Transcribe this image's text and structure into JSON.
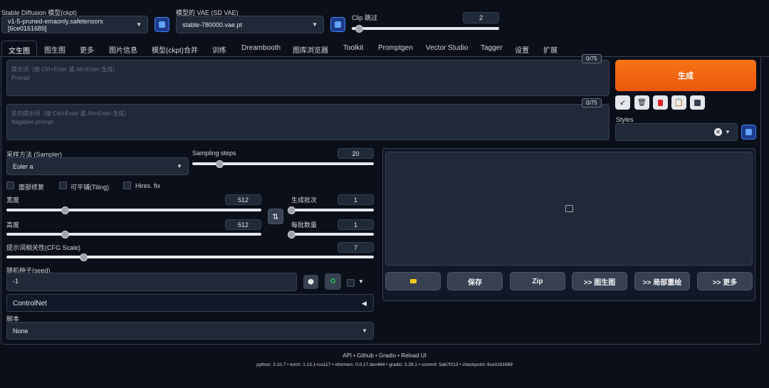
{
  "top": {
    "ckpt_label": "Stable Diffusion 模型(ckpt)",
    "ckpt_value": "v1-5-pruned-emaonly.safetensors [6ce0161689]",
    "vae_label": "模型的 VAE (SD VAE)",
    "vae_value": "stable-780000.vae.pt",
    "clip_label": "Clip 跳过",
    "clip_value": "2",
    "clip_fraction": 0.05
  },
  "tabs": [
    "文生图",
    "图生图",
    "更多",
    "图片信息",
    "模型(ckpt)合并",
    "训练",
    "Dreambooth",
    "图库浏览器",
    "Toolkit",
    "Promptgen",
    "Vector Studio",
    "Tagger",
    "设置",
    "扩展"
  ],
  "prompt": {
    "placeholder_cn": "提示词（按 Ctrl+Enter 或 Alt+Enter 生成）",
    "placeholder_en": "Prompt",
    "counter": "0/75"
  },
  "negative_prompt": {
    "placeholder_cn": "反向提示词（按 Ctrl+Enter 或 Alt+Enter 生成）",
    "placeholder_en": "Negative prompt",
    "counter": "0/75"
  },
  "generate_label": "生成",
  "styles_label": "Styles",
  "sampler": {
    "label": "采样方法 (Sampler)",
    "value": "Euler a"
  },
  "steps": {
    "label": "Sampling steps",
    "value": "20",
    "fraction": 0.15
  },
  "checkboxes": {
    "face": "面部修复",
    "tiling": "可平铺(Tiling)",
    "hires": "Hires. fix"
  },
  "width": {
    "label": "宽度",
    "value": "512",
    "fraction": 0.23
  },
  "height": {
    "label": "高度",
    "value": "512",
    "fraction": 0.23
  },
  "batch_count": {
    "label": "生成批次",
    "value": "1",
    "fraction": 0.0
  },
  "batch_size": {
    "label": "每批数量",
    "value": "1",
    "fraction": 0.0
  },
  "cfg": {
    "label": "提示词相关性(CFG Scale)",
    "value": "7",
    "fraction": 0.21
  },
  "seed": {
    "label": "随机种子(seed)",
    "value": "-1"
  },
  "controlnet_label": "ControlNet",
  "script": {
    "label": "脚本",
    "value": "None"
  },
  "output_buttons": {
    "save": "保存",
    "zip": "Zip",
    "img2img": ">> 图生图",
    "inpaint": ">> 局部重绘",
    "more": ">> 更多"
  },
  "footer": {
    "links": "API • Github • Gradio • Reload UI",
    "versions": "python: 3.10.7  •  torch: 1.13.1+cu117  •  xformers: 0.0.17.dev464  •  gradio: 3.28.1  •  commit: 5ab7f213  •  checkpoint: 6ce0161689"
  },
  "icons": {
    "refresh": "refresh-icon",
    "swap": "swap-arrows-icon",
    "image_placeholder": "image-icon",
    "folder": "folder-icon",
    "dice": "dice-icon",
    "recycle": "recycle-icon",
    "arrow_tool": "arrow-icon",
    "trash": "trash-icon",
    "red_card": "red-card-icon",
    "clipboard": "clipboard-icon",
    "save_style": "save-icon"
  },
  "colors": {
    "accent": "#ea580c",
    "background": "#0b0f19",
    "panel": "#1f2937"
  }
}
